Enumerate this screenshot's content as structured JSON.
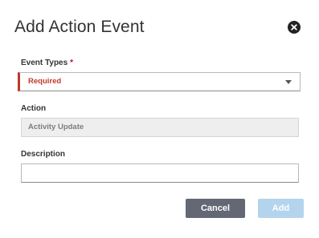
{
  "dialog": {
    "title": "Add Action Event",
    "close_icon": "close-circle-icon"
  },
  "event_types": {
    "label": "Event Types",
    "required_marker": "*",
    "value": "Required",
    "error_color": "#c0392b",
    "dropdown_icon": "caret-down-icon"
  },
  "action": {
    "label": "Action",
    "value": "Activity Update"
  },
  "description": {
    "label": "Description",
    "value": ""
  },
  "buttons": {
    "cancel_label": "Cancel",
    "add_label": "Add"
  },
  "colors": {
    "cancel_bg": "#636874",
    "add_bg_disabled": "#b4d4ee",
    "required_star": "#d0021b"
  }
}
